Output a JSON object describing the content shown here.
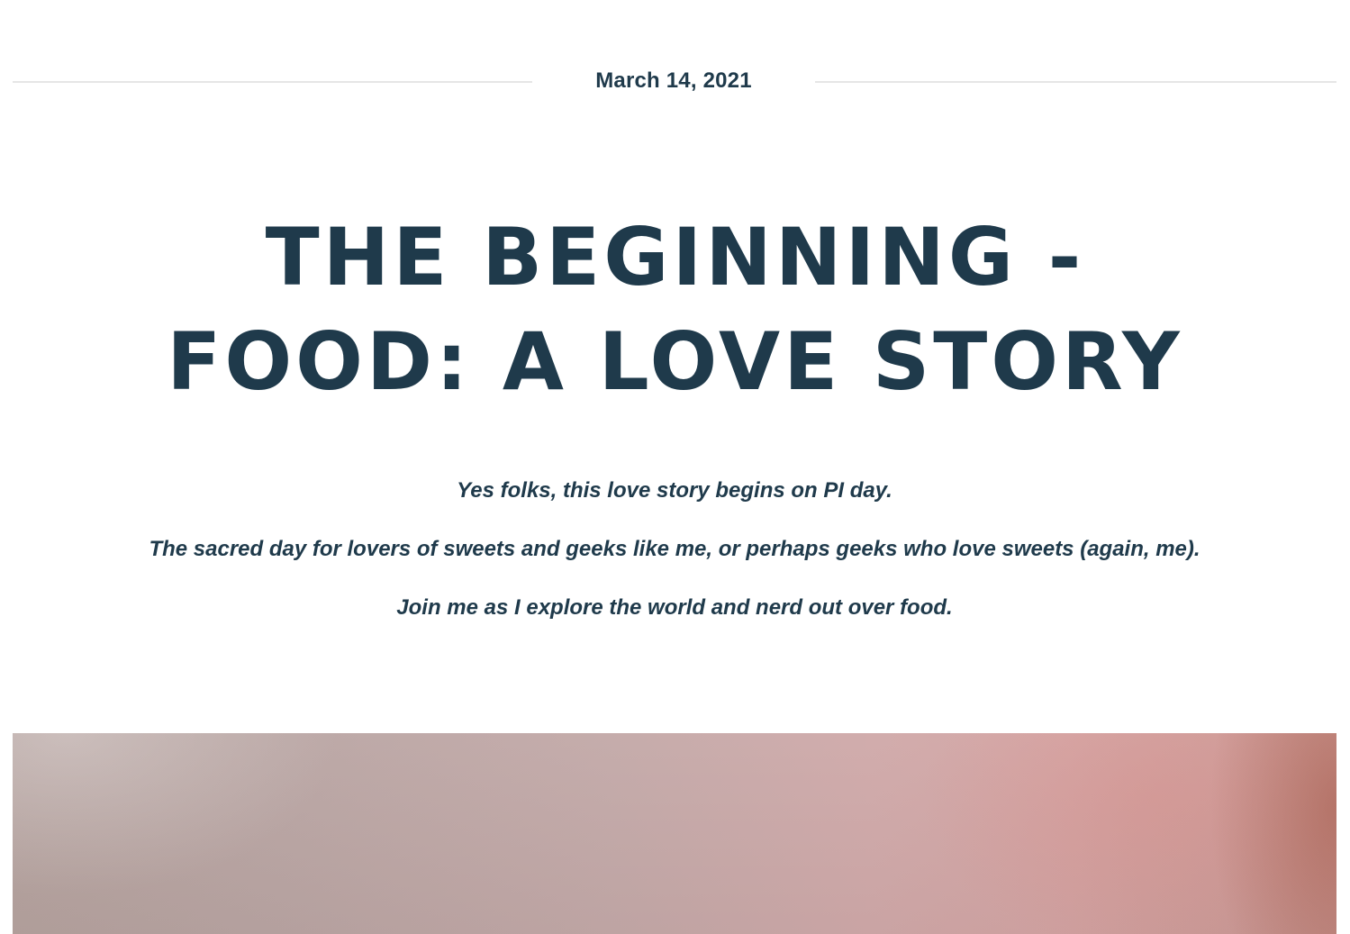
{
  "post": {
    "date": "March 14, 2021",
    "title_lines": [
      "THE BEGINNING -",
      "FOOD: A LOVE STORY"
    ],
    "intro": [
      "Yes folks, this love story begins on PI day.",
      "The sacred day for lovers of sweets and geeks like me, or perhaps geeks who love sweets (again, me).",
      "Join me as I explore the world and nerd out over food."
    ]
  },
  "colors": {
    "text": "#1f3a4b",
    "rule": "#e6e6e6",
    "background": "#ffffff"
  }
}
